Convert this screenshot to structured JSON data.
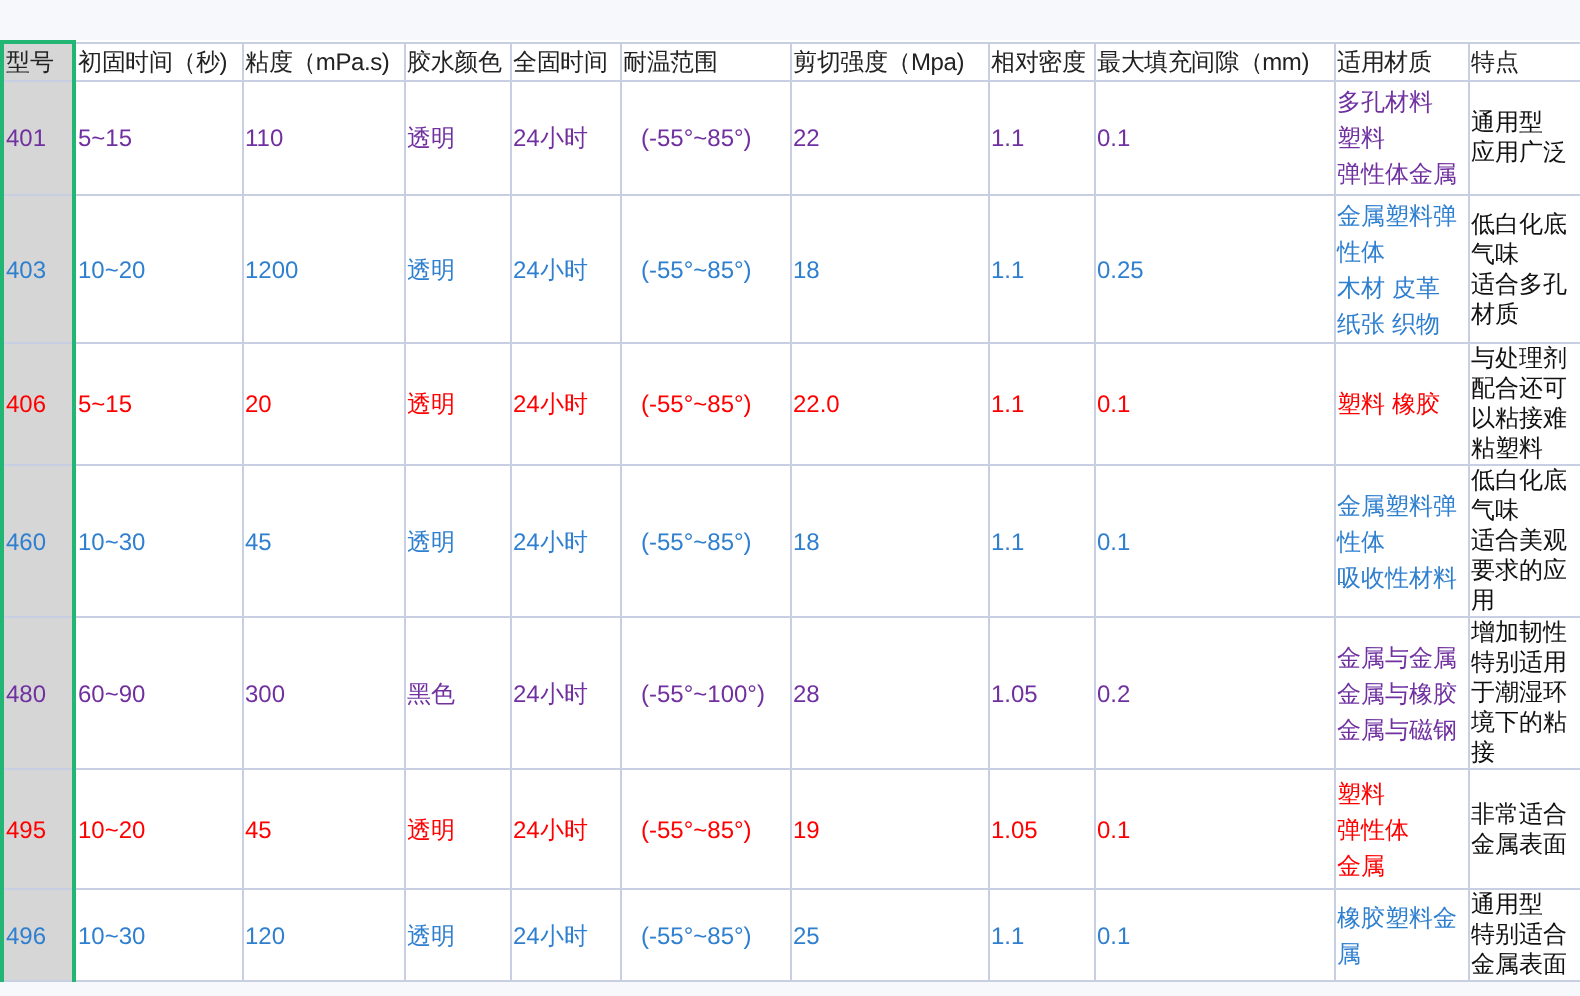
{
  "table": {
    "columns": [
      {
        "label": "型号",
        "selected": true
      },
      {
        "label": "初固时间（秒)",
        "selected": false
      },
      {
        "label": "粘度（mPa.s)",
        "selected": false
      },
      {
        "label": "胶水颜色",
        "selected": false
      },
      {
        "label": "全固时间",
        "selected": false
      },
      {
        "label": "耐温范围",
        "selected": false
      },
      {
        "label": "剪切强度（Mpa)",
        "selected": false
      },
      {
        "label": "相对密度",
        "selected": false
      },
      {
        "label": "最大填充间隙（mm)",
        "selected": false
      },
      {
        "label": "适用材质",
        "selected": false
      },
      {
        "label": "特点",
        "selected": false
      }
    ],
    "rows": [
      {
        "color": "#7030a0",
        "model": "401",
        "initial_cure": "5~15",
        "viscosity": "110",
        "glue_color": "透明",
        "full_cure": "24小时",
        "temperature": "(-55°~85°)",
        "shear_strength": "22",
        "density": "1.1",
        "max_gap": "0.1",
        "materials": [
          "多孔材料",
          "塑料",
          "弹性体金属"
        ],
        "features": [
          "通用型",
          "应用广泛"
        ]
      },
      {
        "color": "#2e7fcf",
        "model": "403",
        "initial_cure": "10~20",
        "viscosity": "1200",
        "glue_color": "透明",
        "full_cure": "24小时",
        "temperature": "(-55°~85°)",
        "shear_strength": "18",
        "density": "1.1",
        "max_gap": "0.25",
        "materials": [
          "金属塑料弹",
          "性体",
          "木材 皮革",
          "纸张 织物"
        ],
        "features": [
          "低白化底",
          "气味",
          "适合多孔",
          "材质"
        ]
      },
      {
        "color": "#ff0000",
        "model": "406",
        "initial_cure": "5~15",
        "viscosity": "20",
        "glue_color": "透明",
        "full_cure": "24小时",
        "temperature": "(-55°~85°)",
        "shear_strength": "22.0",
        "density": "1.1",
        "max_gap": "0.1",
        "materials": [
          "塑料 橡胶"
        ],
        "features": [
          "与处理剂",
          "配合还可",
          "以粘接难",
          "粘塑料"
        ]
      },
      {
        "color": "#2e7fcf",
        "model": "460",
        "initial_cure": "10~30",
        "viscosity": "45",
        "glue_color": "透明",
        "full_cure": "24小时",
        "temperature": "(-55°~85°)",
        "shear_strength": "18",
        "density": "1.1",
        "max_gap": "0.1",
        "materials": [
          "金属塑料弹",
          "性体",
          "吸收性材料"
        ],
        "features": [
          "低白化底",
          "气味",
          "适合美观",
          "要求的应",
          "用"
        ]
      },
      {
        "color": "#7030a0",
        "model": "480",
        "initial_cure": "60~90",
        "viscosity": "300",
        "glue_color": "黑色",
        "full_cure": "24小时",
        "temperature": "(-55°~100°)",
        "shear_strength": "28",
        "density": "1.05",
        "max_gap": "0.2",
        "materials": [
          "金属与金属",
          "金属与橡胶",
          "金属与磁钢"
        ],
        "features": [
          "增加韧性",
          "特别适用",
          "于潮湿环",
          "境下的粘",
          "接"
        ]
      },
      {
        "color": "#ff0000",
        "model": "495",
        "initial_cure": "10~20",
        "viscosity": "45",
        "glue_color": "透明",
        "full_cure": "24小时",
        "temperature": "(-55°~85°)",
        "shear_strength": "19",
        "density": "1.05",
        "max_gap": "0.1",
        "materials": [
          "塑料",
          "弹性体",
          "金属"
        ],
        "features": [
          "非常适合",
          "金属表面"
        ]
      },
      {
        "color": "#2e7fcf",
        "model": "496",
        "initial_cure": "10~30",
        "viscosity": "120",
        "glue_color": "透明",
        "full_cure": "24小时",
        "temperature": "(-55°~85°)",
        "shear_strength": "25",
        "density": "1.1",
        "max_gap": "0.1",
        "materials": [
          "橡胶塑料金",
          "属"
        ],
        "features": [
          "通用型",
          "特别适合",
          "金属表面"
        ]
      }
    ]
  }
}
